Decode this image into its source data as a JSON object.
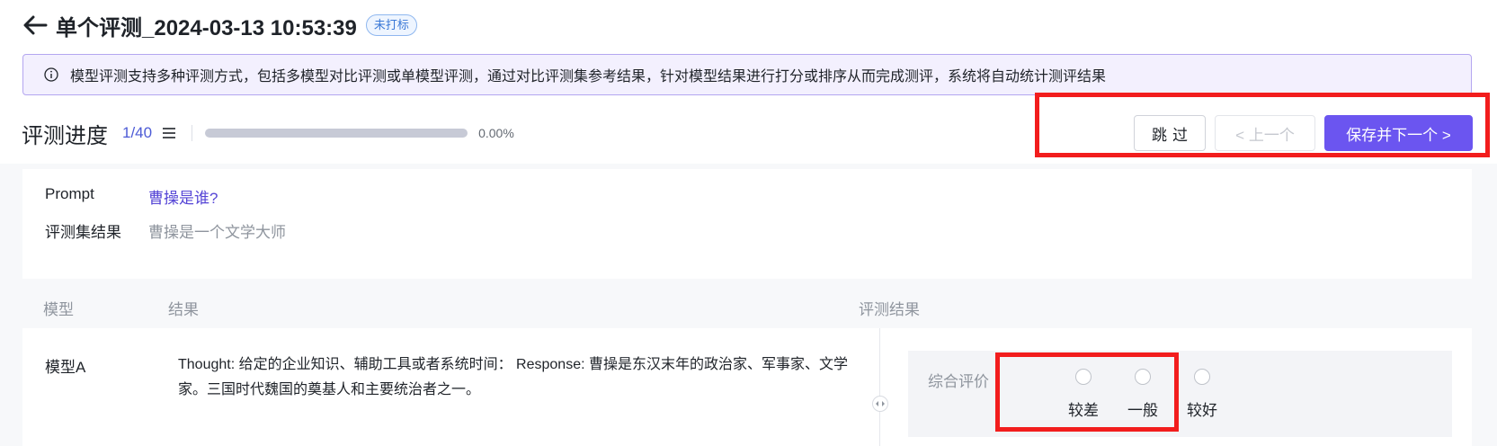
{
  "header": {
    "title": "单个评测_2024-03-13 10:53:39",
    "badge": "未打标"
  },
  "notice": {
    "text": "模型评测支持多种评测方式，包括多模型对比评测或单模型评测，通过对比评测集参考结果，针对模型结果进行打分或排序从而完成测评，系统将自动统计测评结果"
  },
  "progress": {
    "title": "评测进度",
    "count": "1/40",
    "percent_text": "0.00%",
    "percent_value": 0
  },
  "actions": {
    "skip": "跳过",
    "prev": "< 上一个",
    "next": "保存并下一个 >"
  },
  "prompt": {
    "label": "Prompt",
    "value": "曹操是谁?",
    "reference_label": "评测集结果",
    "reference_value": "曹操是一个文学大师"
  },
  "table": {
    "headers": {
      "model": "模型",
      "result": "结果",
      "evaluation": "评测结果"
    },
    "rows": [
      {
        "model": "模型A",
        "result": "Thought: 给定的企业知识、辅助工具或者系统时间： Response: 曹操是东汉末年的政治家、军事家、文学家。三国时代魏国的奠基人和主要统治者之一。",
        "eval_label": "综合评价",
        "options": [
          "较差",
          "一般",
          "较好"
        ]
      }
    ]
  },
  "colors": {
    "accent": "#6b55f0",
    "highlight": "#f21d1d",
    "notice_bg": "#f3f0fe"
  },
  "icons": [
    "arrow-left-icon",
    "info-icon",
    "list-icon",
    "drag-handle-icon"
  ]
}
